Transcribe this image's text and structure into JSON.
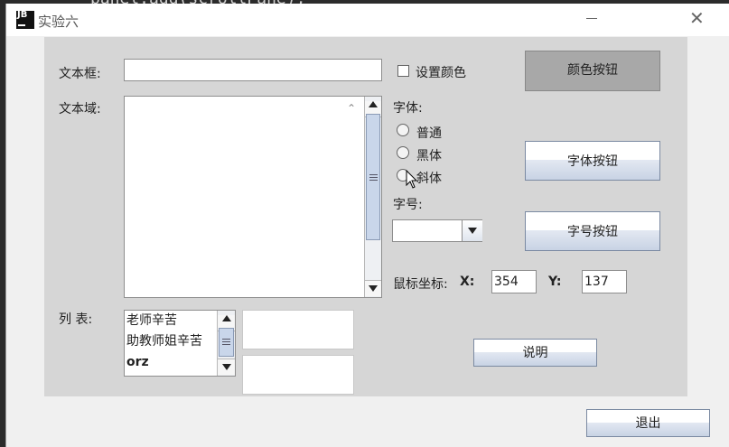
{
  "window": {
    "title": "实验六",
    "app_icon_text": "JB",
    "minimize_icon": "minimize-icon",
    "close_icon": "close-icon"
  },
  "background_code": "panel.add(scrollPane);",
  "text_field": {
    "label": "文本框:",
    "value": ""
  },
  "set_color": {
    "label": "设置颜色",
    "checked": false
  },
  "color_button": {
    "label": "颜色按钮"
  },
  "text_area": {
    "label": "文本域:",
    "value": ""
  },
  "font": {
    "label": "字体:",
    "options": [
      {
        "label": "普通",
        "selected": false
      },
      {
        "label": "黑体",
        "selected": false
      },
      {
        "label": "斜体",
        "selected": false
      }
    ]
  },
  "font_button": {
    "label": "字体按钮"
  },
  "size": {
    "label": "字号:",
    "selected": ""
  },
  "size_button": {
    "label": "字号按钮"
  },
  "mouse": {
    "label": "鼠标坐标:",
    "x_label": "X:",
    "x_value": "354",
    "y_label": "Y:",
    "y_value": "137"
  },
  "list": {
    "label": "列 表:",
    "items": [
      "老师辛苦",
      "助教师姐辛苦",
      "orz"
    ]
  },
  "info_button": {
    "label": "说明"
  },
  "exit_button": {
    "label": "退出"
  },
  "colors": {
    "panel_bg": "#d6d6d6",
    "window_bg": "#f0f0f0",
    "color_button_bg": "#a8a8a8",
    "button_gradient": "#c8d3e4"
  }
}
